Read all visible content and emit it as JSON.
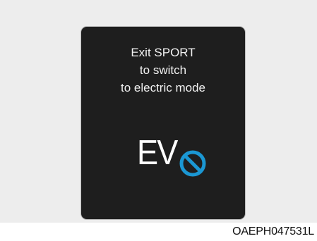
{
  "display": {
    "message_lines": [
      "Exit SPORT",
      "to switch",
      "to electric mode"
    ],
    "ev_label": "EV",
    "prohibit_icon": "no-entry-circle-icon",
    "colors": {
      "screen_background": "#1e1e1e",
      "text": "#f2f2f2",
      "prohibit_symbol": "#1b97d3"
    }
  },
  "caption": {
    "code": "OAEPH047531L"
  }
}
